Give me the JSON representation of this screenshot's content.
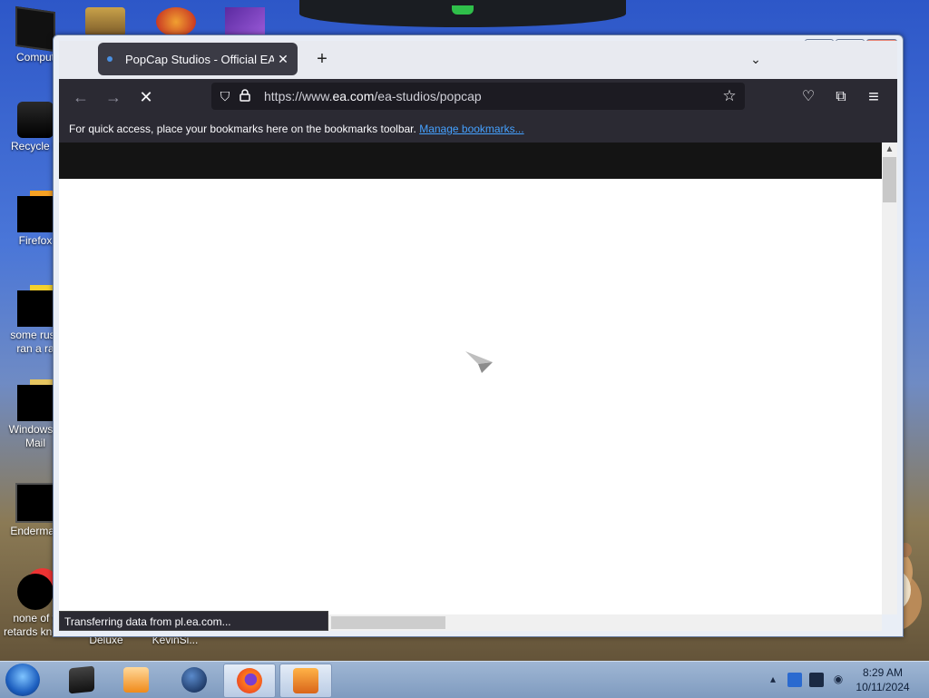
{
  "desktop": {
    "icons": [
      {
        "label": "Comput",
        "lines": [
          "Comput"
        ]
      },
      {
        "label": "Recycle B",
        "lines": [
          "Recycle B"
        ]
      },
      {
        "label": "Firefox",
        "lines": [
          "Firefox"
        ]
      },
      {
        "label": "some russ ran a ra",
        "lines": [
          "some russ",
          "ran a ra"
        ]
      },
      {
        "label": "Windows L Mail",
        "lines": [
          "Windows L",
          "Mail"
        ]
      },
      {
        "label": "Enderman",
        "lines": [
          "Enderman"
        ]
      },
      {
        "label": "none of y retards kno...",
        "lines": [
          "none of y",
          "retards kno..."
        ]
      },
      {
        "label": "Deluxe",
        "lines": [
          "Deluxe"
        ]
      },
      {
        "label": "KevinSi...",
        "lines": [
          "KevinSi..."
        ]
      }
    ]
  },
  "window": {
    "caption_buttons": {
      "minimize": "▭",
      "maximize": "▢",
      "close": "✕"
    }
  },
  "tabs": [
    {
      "title": "PopCap Studios - Official EA Si",
      "close": "✕",
      "active": true
    }
  ],
  "tabstrip": {
    "new_tab": "+",
    "list_all": "⌄"
  },
  "navbar": {
    "back_icon": "←",
    "forward_icon": "→",
    "stop_icon": "✕",
    "url_prefix": "https://www.",
    "url_host": "ea.com",
    "url_path": "/ea-studios/popcap",
    "shield_icon": "⛉",
    "lock_icon": "🔒",
    "bookmark_star_icon": "☆",
    "pocket_icon": "♡",
    "extensions_icon": "⧉",
    "menu_icon": "≡"
  },
  "bookmarks_bar": {
    "text": "For quick access, place your bookmarks here on the bookmarks toolbar.",
    "link": "Manage bookmarks..."
  },
  "status_bar": {
    "text": "Transferring data from pl.ea.com..."
  },
  "taskbar": {
    "items": [
      "file-manager",
      "media-player",
      "globe",
      "firefox",
      "app"
    ],
    "active": "firefox"
  },
  "tray": {
    "time": "8:29 AM",
    "date": "10/11/2024"
  },
  "colors": {
    "accent_link": "#45a1ff",
    "toolbar_dark": "#2b2a33",
    "tab_active": "#3b3b45"
  }
}
